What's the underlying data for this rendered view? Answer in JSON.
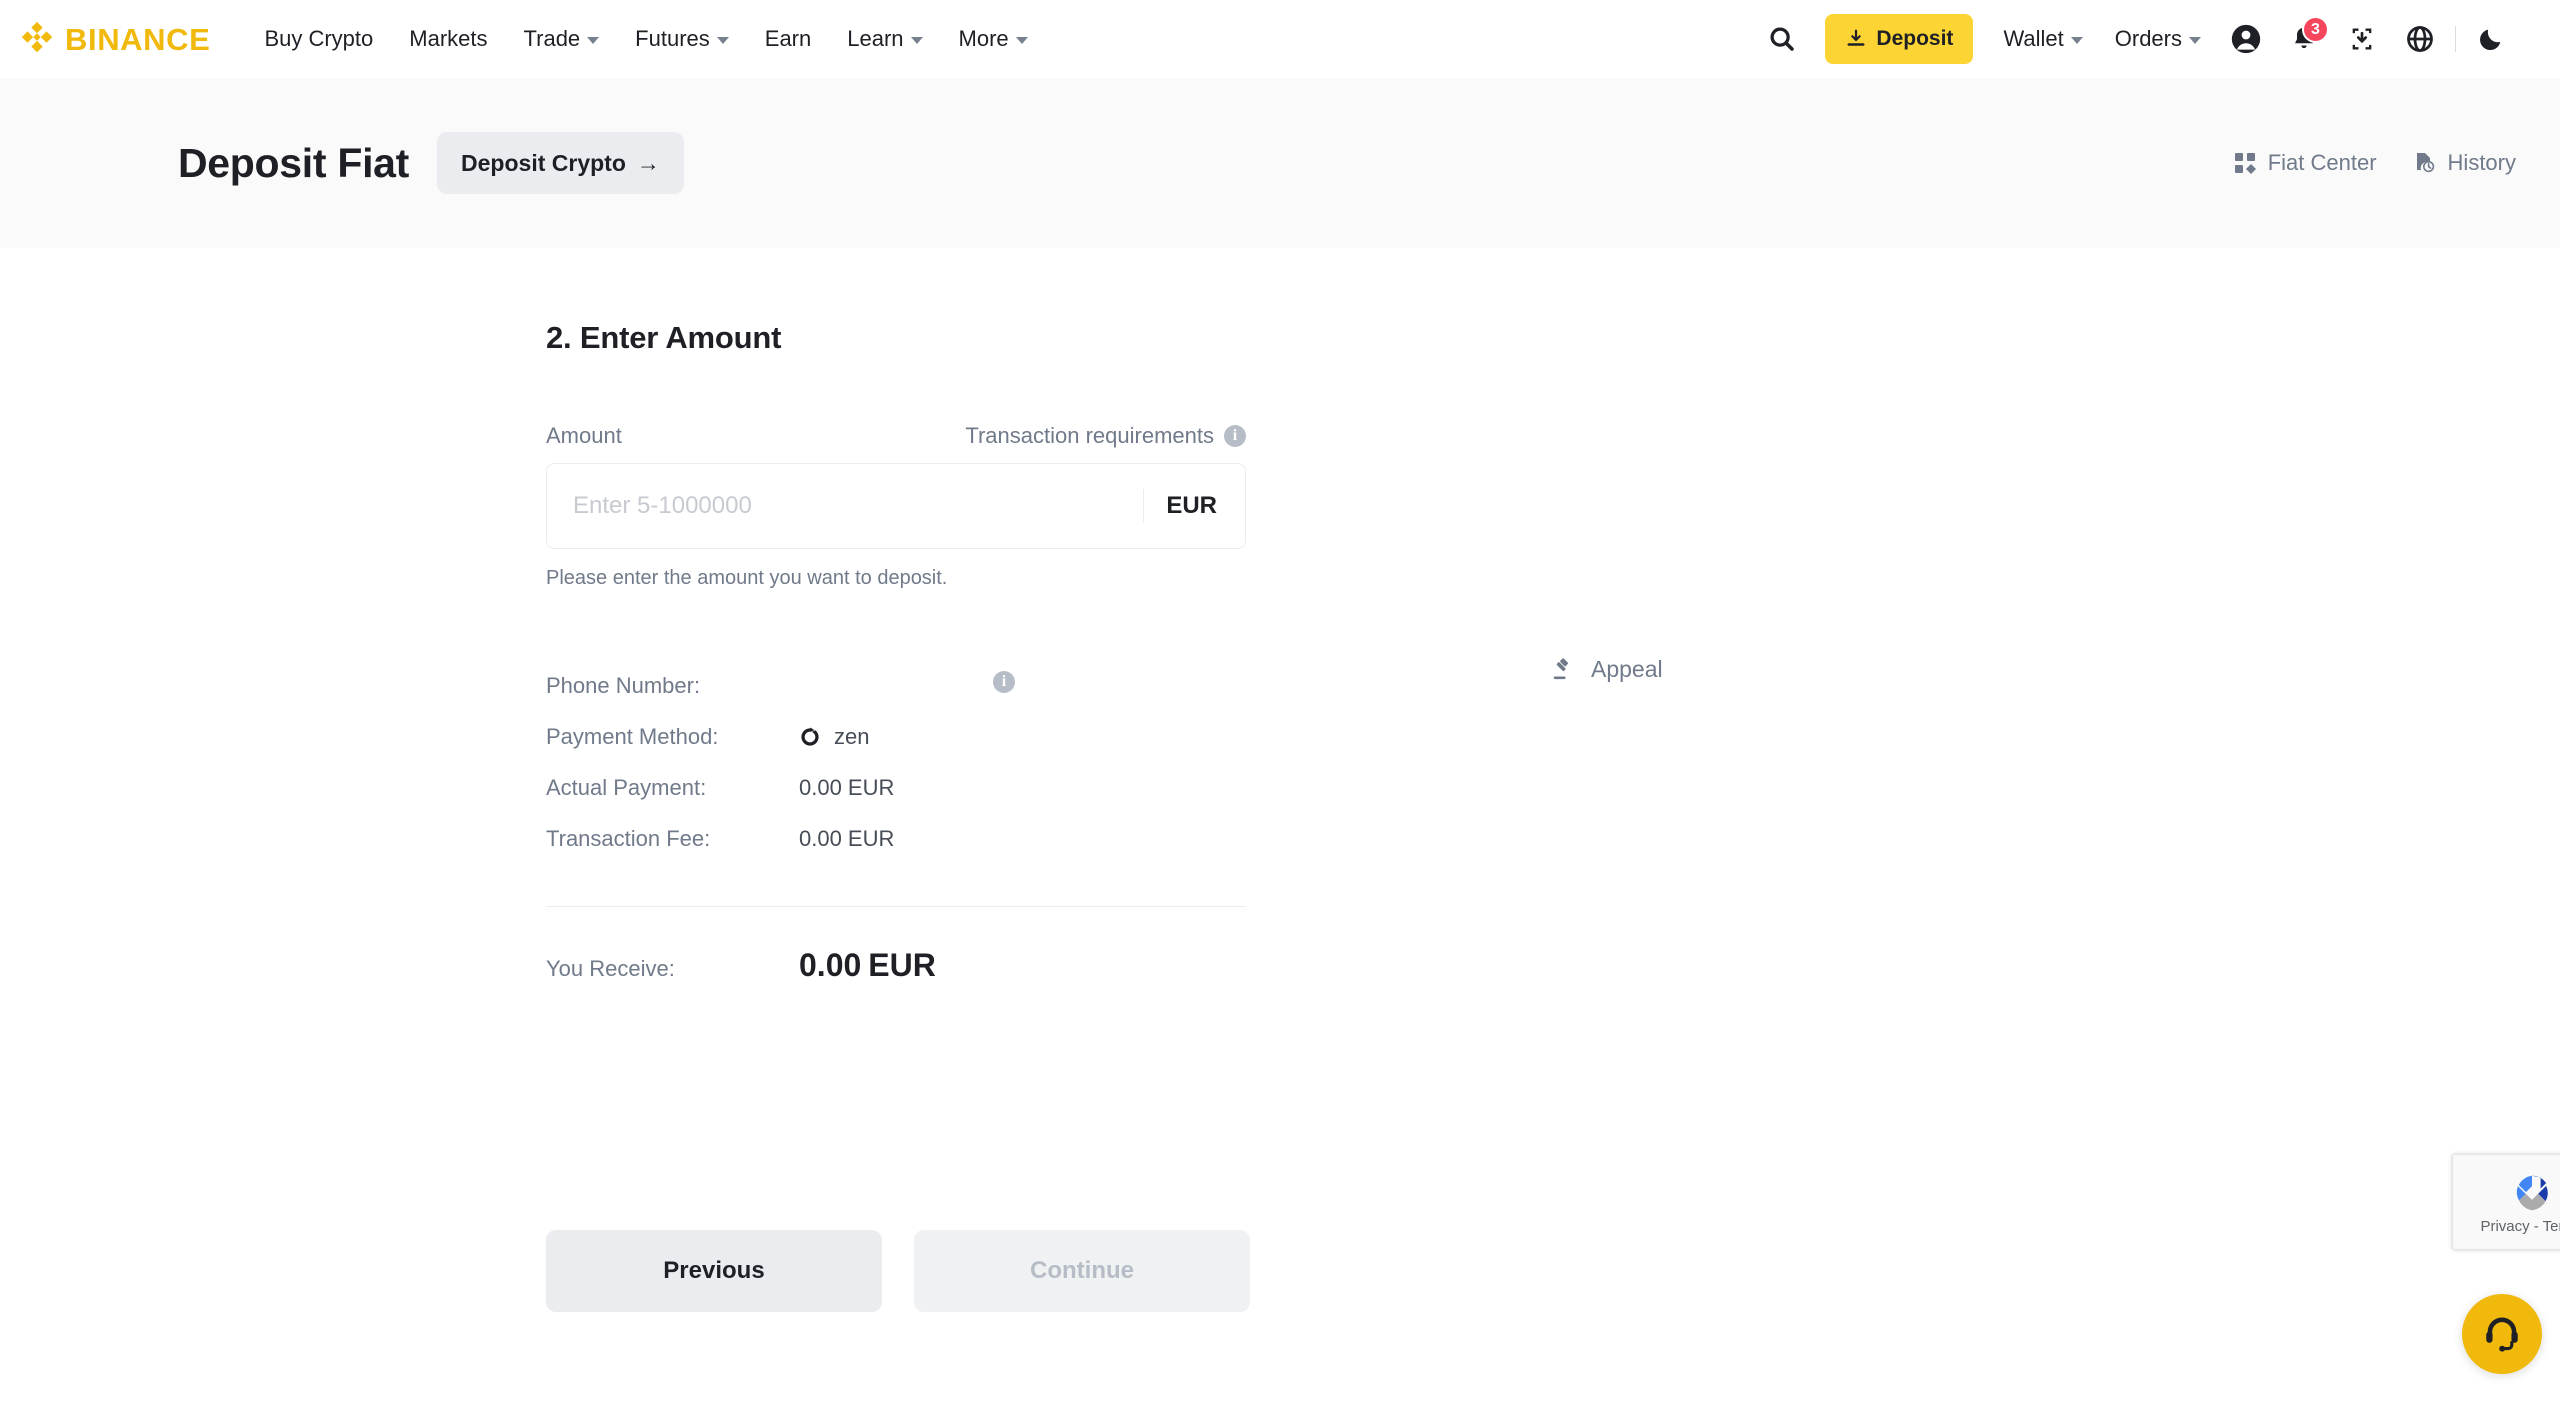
{
  "brand": {
    "name": "BINANCE",
    "accent_color": "#F0B90B",
    "deposit_btn_color": "#FCD535"
  },
  "navbar": {
    "links": [
      {
        "label": "Buy Crypto",
        "has_caret": false
      },
      {
        "label": "Markets",
        "has_caret": false
      },
      {
        "label": "Trade",
        "has_caret": true
      },
      {
        "label": "Futures",
        "has_caret": true
      },
      {
        "label": "Earn",
        "has_caret": false
      },
      {
        "label": "Learn",
        "has_caret": true
      },
      {
        "label": "More",
        "has_caret": true
      }
    ],
    "search_icon": "search-icon",
    "deposit_label": "Deposit",
    "deposit_icon": "download-icon",
    "wallet_label": "Wallet",
    "orders_label": "Orders",
    "profile_icon": "user-circle-icon",
    "notification_icon": "bell-icon",
    "notification_count": "3",
    "notification_badge_color": "#F6465D",
    "inbox_icon": "download-box-icon",
    "language_icon": "globe-icon",
    "theme_icon": "moon-icon"
  },
  "subheader": {
    "title": "Deposit Fiat",
    "deposit_crypto_label": "Deposit Crypto",
    "deposit_crypto_arrow": "→",
    "fiat_center_label": "Fiat Center",
    "fiat_center_icon": "grid-icon",
    "history_label": "History",
    "history_icon": "document-clock-icon"
  },
  "main": {
    "step_title": "2. Enter Amount",
    "amount_label": "Amount",
    "transaction_requirements_label": "Transaction requirements",
    "transaction_requirements_icon": "info-icon",
    "amount_placeholder": "Enter 5-1000000",
    "amount_value": "",
    "currency": "EUR",
    "hint": "Please enter the amount you want to deposit.",
    "details": [
      {
        "label": "Phone Number:",
        "value": "",
        "icon": "",
        "info": "info-icon"
      },
      {
        "label": "Payment Method:",
        "value": "zen",
        "icon": "zen-logo-icon",
        "info": ""
      },
      {
        "label": "Actual Payment:",
        "value": "0.00 EUR",
        "icon": "",
        "info": ""
      },
      {
        "label": "Transaction Fee:",
        "value": "0.00 EUR",
        "icon": "",
        "info": ""
      }
    ],
    "receive_label": "You Receive:",
    "receive_amount": "0.00",
    "receive_currency": "EUR",
    "previous_label": "Previous",
    "continue_label": "Continue",
    "appeal_label": "Appeal",
    "appeal_icon": "gavel-icon"
  },
  "overlays": {
    "recaptcha_text": "Privacy - Terms",
    "recaptcha_icon": "recaptcha-icon",
    "support_icon": "headset-icon",
    "support_color": "#F0B90B"
  }
}
